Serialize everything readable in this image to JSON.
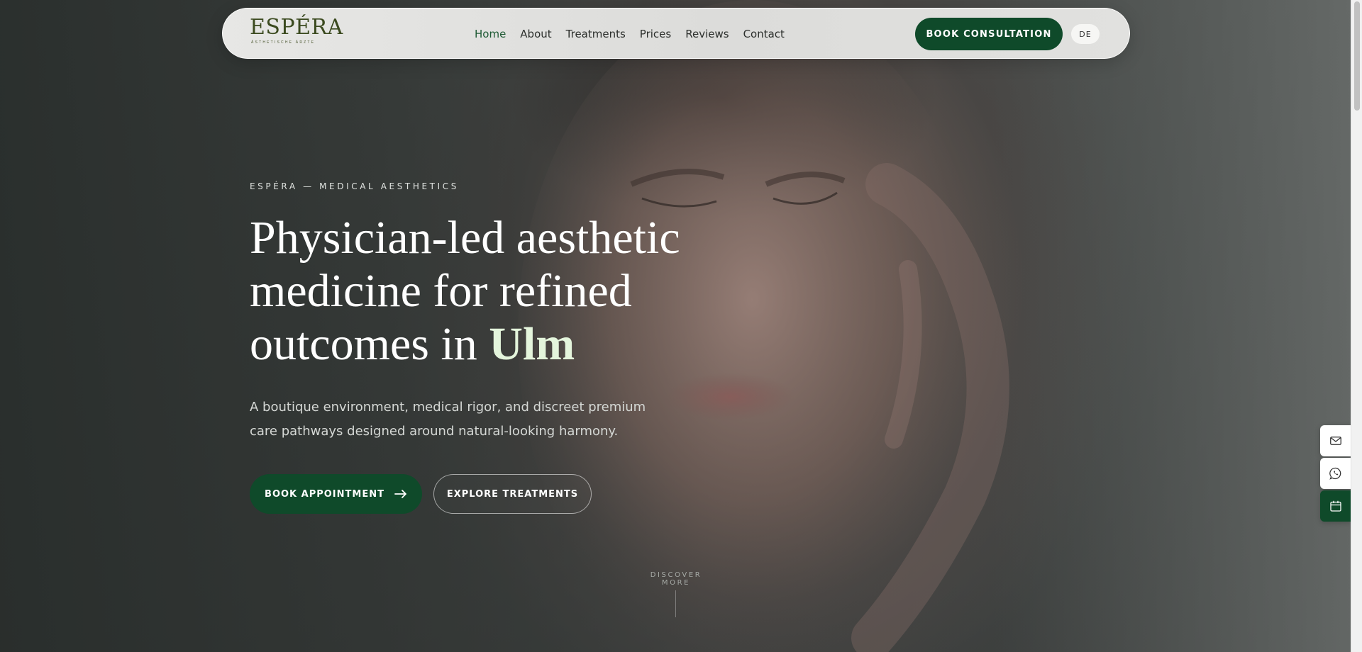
{
  "brand": {
    "logo_word": "ESPÉRA",
    "logo_tagline": "ÄSTHETISCHE ÄRZTE"
  },
  "nav": {
    "links": [
      {
        "label": "Home",
        "active": true
      },
      {
        "label": "About",
        "active": false
      },
      {
        "label": "Treatments",
        "active": false
      },
      {
        "label": "Prices",
        "active": false
      },
      {
        "label": "Reviews",
        "active": false
      },
      {
        "label": "Contact",
        "active": false
      }
    ],
    "cta_label": "BOOK CONSULTATION",
    "language_label": "DE"
  },
  "hero": {
    "eyebrow": "ESPÉRA — MEDICAL AESTHETICS",
    "headline_line1": "Physician-led aesthetic",
    "headline_line2": "medicine for refined",
    "headline_line3_prefix": "outcomes in ",
    "headline_accent": "Ulm",
    "subtext": "A boutique environment, medical rigor, and discreet premium care pathways designed around natural-looking harmony.",
    "primary_cta": "BOOK APPOINTMENT",
    "secondary_cta": "EXPLORE TREATMENTS",
    "scroll_hint": "DISCOVER MORE"
  },
  "side_rail": {
    "icons": [
      "mail-icon",
      "whatsapp-icon",
      "calendar-icon"
    ]
  },
  "colors": {
    "brand_green": "#0f4a2a",
    "accent_text": "#e4f5dc",
    "nav_active": "#1e5a34"
  }
}
